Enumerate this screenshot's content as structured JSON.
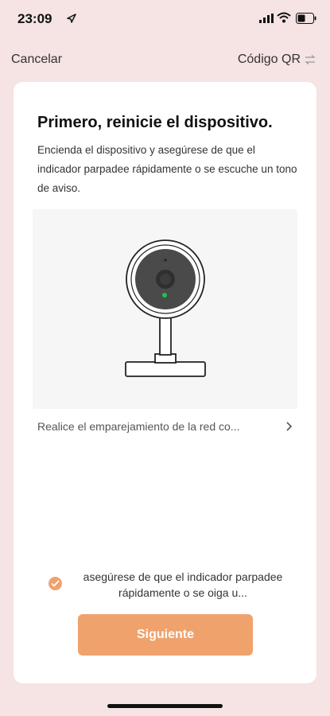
{
  "status": {
    "time": "23:09"
  },
  "nav": {
    "cancel": "Cancelar",
    "qr": "Código QR"
  },
  "card": {
    "title": "Primero, reinicie el dispositivo.",
    "description": "Encienda el dispositivo y asegúrese de que el indicador parpadee rápidamente o se escuche un tono de aviso.",
    "pair_link": "Realice el emparejamiento de la red co...",
    "confirm_text": "asegúrese de que el indicador parpadee rápidamente o se oiga u...",
    "confirm_checked": true,
    "next_button": "Siguiente"
  },
  "colors": {
    "background": "#f6e3e3",
    "accent": "#f0a26d",
    "card": "#ffffff"
  },
  "icons": [
    "location-arrow-icon",
    "signal-icon",
    "wifi-icon",
    "battery-icon",
    "swap-icon",
    "camera-illustration",
    "chevron-right-icon",
    "check-icon"
  ]
}
